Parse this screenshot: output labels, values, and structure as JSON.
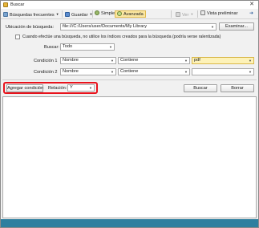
{
  "window": {
    "title": "Buscar",
    "close_glyph": "✕"
  },
  "toolbar": {
    "frequent_searches": "Búsquedas frecuentes",
    "save": "Guardar",
    "simple": "Simple",
    "advanced": "Avanzada",
    "view": "Ver",
    "preview": "Vista preliminar",
    "icons": {
      "frequent_searches": "search-list-icon",
      "save": "save-icon",
      "simple": "simple-search-icon",
      "advanced": "advanced-search-icon",
      "view": "view-icon",
      "preview": "preview-icon",
      "pin": "pin-icon"
    }
  },
  "search_location": {
    "label": "Ubicación de búsqueda:",
    "value": "file:///C:/Users/user/Documents/My Library",
    "browse_button": "Examinar..."
  },
  "index_option": {
    "label": "Cuando efectúe una búsqueda, no utilice los índices creados para la búsqueda (podría verse ralentizada)",
    "checked": false
  },
  "search_scope": {
    "label": "Buscar:",
    "value": "Todo"
  },
  "conditions": [
    {
      "label": "Condición 1",
      "field": "Nombre",
      "operator": "Contiene",
      "value": "pdf"
    },
    {
      "label": "Condición 2",
      "field": "Nombre",
      "operator": "Contiene",
      "value": ""
    }
  ],
  "actions": {
    "add_condition": "Agregar condición",
    "relation_label": "Relación:",
    "relation_value": "Y",
    "search_button": "Buscar",
    "clear_button": "Borrar"
  },
  "colors": {
    "highlight": "#e8131c",
    "statusbar": "#2e7f9f",
    "active_input": "#fdf2b8"
  }
}
